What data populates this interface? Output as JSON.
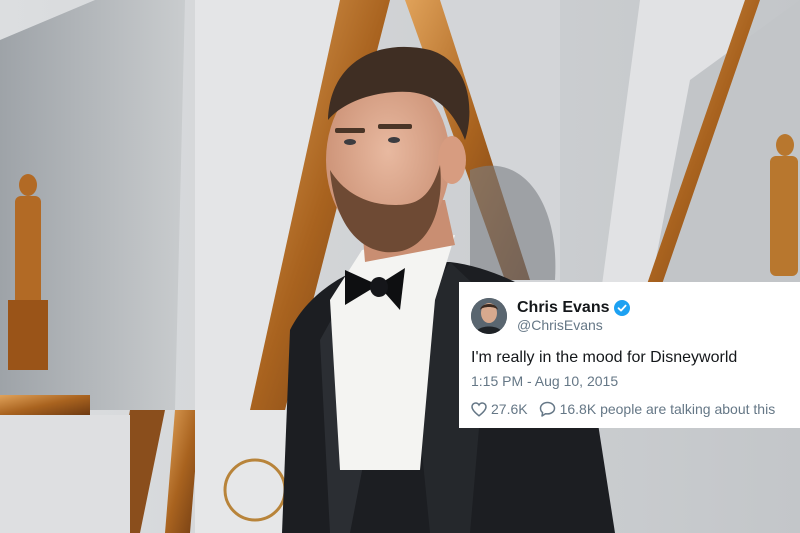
{
  "tweet": {
    "name": "Chris Evans",
    "handle": "@ChrisEvans",
    "verified": true,
    "text": "I'm really in the mood for Disneyworld",
    "timestamp": "1:15 PM - Aug 10, 2015",
    "likes": "27.6K",
    "talking": "16.8K people are talking about this",
    "icons": {
      "like": "heart-icon",
      "reply": "speech-bubble-icon",
      "verified": "verified-badge-icon"
    },
    "colors": {
      "verified": "#1da1f2",
      "text": "#14171a",
      "secondary": "#657786"
    }
  },
  "photo": {
    "subject": "man in black tuxedo with bow tie",
    "backdrop_colors": {
      "panel": "#d9dbdd",
      "gold": "#b3742c",
      "tux": "#1a1c20"
    }
  }
}
